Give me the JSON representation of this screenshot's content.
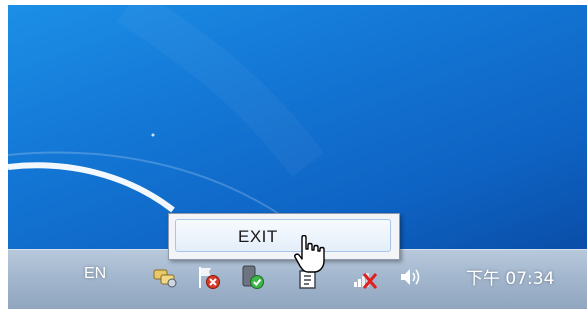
{
  "taskbar": {
    "language": "EN",
    "clock": "下午 07:34"
  },
  "context_menu": {
    "items": [
      {
        "label": "EXIT"
      }
    ]
  },
  "tray_icons": [
    "network-connection-icon",
    "flag-error-icon",
    "security-check-icon",
    "device-icon",
    "network-disconnected-icon",
    "volume-icon"
  ],
  "colors": {
    "desktop": "#1478d6",
    "taskbar": "#a3b7ce",
    "menu_background": "#f2f4f8",
    "menu_highlight": "#e4eef9"
  }
}
